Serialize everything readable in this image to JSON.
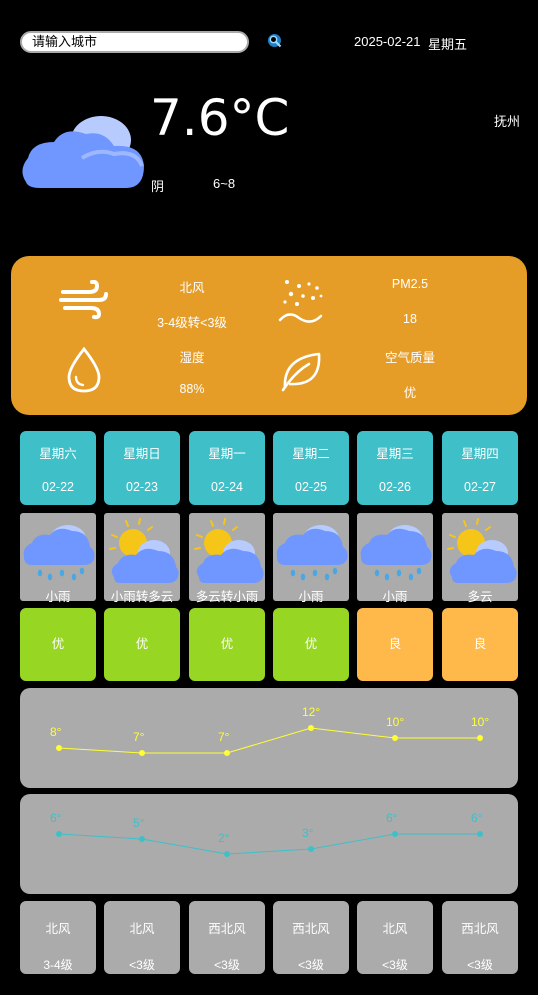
{
  "search": {
    "value": "请输入城市"
  },
  "header": {
    "date": "2025-02-21",
    "weekday": "星期五"
  },
  "current": {
    "temperature": "7.6°C",
    "city": "抚州",
    "condition": "阴",
    "range": "6~8",
    "icon": "cloud-icon"
  },
  "panel": {
    "wind_direction": "北风",
    "wind_level": "3-4级转<3级",
    "pm25_label": "PM2.5",
    "pm25_value": "18",
    "humidity_label": "湿度",
    "humidity_value": "88%",
    "aqi_label": "空气质量",
    "aqi_value": "优",
    "color": "#e69d28"
  },
  "forecast": [
    {
      "weekday": "星期六",
      "date": "02-22",
      "weather": "小雨",
      "icon": "rain-icon",
      "air": "优",
      "air_color": "#97d623",
      "high": "8°",
      "low": "6°",
      "wind_dir": "北风",
      "wind_level": "3-4级"
    },
    {
      "weekday": "星期日",
      "date": "02-23",
      "weather": "小雨转多云",
      "icon": "sun-cloud-icon",
      "air": "优",
      "air_color": "#97d623",
      "high": "7°",
      "low": "5°",
      "wind_dir": "北风",
      "wind_level": "<3级"
    },
    {
      "weekday": "星期一",
      "date": "02-24",
      "weather": "多云转小雨",
      "icon": "sun-cloud-icon",
      "air": "优",
      "air_color": "#97d623",
      "high": "7°",
      "low": "2°",
      "wind_dir": "西北风",
      "wind_level": "<3级"
    },
    {
      "weekday": "星期二",
      "date": "02-25",
      "weather": "小雨",
      "icon": "rain-icon",
      "air": "优",
      "air_color": "#97d623",
      "high": "12°",
      "low": "3°",
      "wind_dir": "西北风",
      "wind_level": "<3级"
    },
    {
      "weekday": "星期三",
      "date": "02-26",
      "weather": "小雨",
      "icon": "rain-icon",
      "air": "良",
      "air_color": "#ffb94a",
      "high": "10°",
      "low": "6°",
      "wind_dir": "北风",
      "wind_level": "<3级"
    },
    {
      "weekday": "星期四",
      "date": "02-27",
      "weather": "多云",
      "icon": "sun-cloud-icon",
      "air": "良",
      "air_color": "#ffb94a",
      "high": "10°",
      "low": "6°",
      "wind_dir": "西北风",
      "wind_level": "<3级"
    }
  ],
  "chart_data": [
    {
      "type": "line",
      "categories": [
        "02-22",
        "02-23",
        "02-24",
        "02-25",
        "02-26",
        "02-27"
      ],
      "series": [
        {
          "values": [
            8,
            7,
            7,
            12,
            10,
            10
          ]
        }
      ],
      "color": "#ffff33",
      "ylim": [
        0,
        20
      ]
    },
    {
      "type": "line",
      "categories": [
        "02-22",
        "02-23",
        "02-24",
        "02-25",
        "02-26",
        "02-27"
      ],
      "series": [
        {
          "values": [
            6,
            5,
            2,
            3,
            6,
            6
          ]
        }
      ],
      "color": "#3fbfc8",
      "ylim": [
        -6,
        14
      ]
    }
  ]
}
